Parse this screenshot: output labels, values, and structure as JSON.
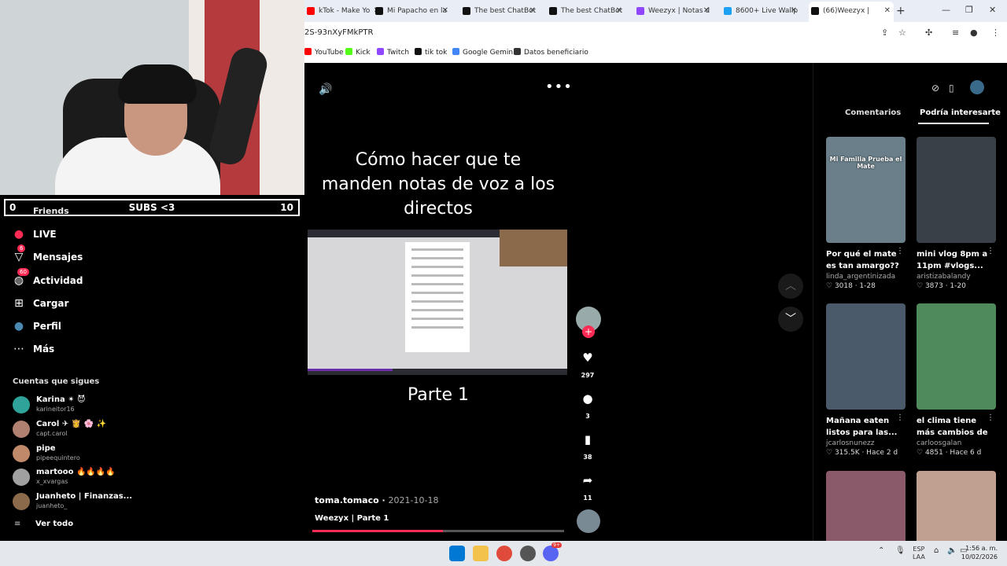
{
  "browser": {
    "tabs": [
      {
        "label": "kTok - Make Yo",
        "color": "#ff0000"
      },
      {
        "label": "Mi Papacho en la",
        "color": "#111111"
      },
      {
        "label": "The best ChatBot",
        "color": "#111111"
      },
      {
        "label": "The best ChatBot",
        "color": "#111111"
      },
      {
        "label": "Weezyx | Notas d",
        "color": "#9146ff"
      },
      {
        "label": "8600+ Live Wallp",
        "color": "#1da1f2"
      },
      {
        "label": "(66)Weezyx |",
        "color": "#111111"
      }
    ],
    "new_tab": "+",
    "url": "2S-93nXyFMkPTR",
    "bookmarks": [
      {
        "label": "YouTube",
        "color": "#ff0000"
      },
      {
        "label": "Kick",
        "color": "#53fc18"
      },
      {
        "label": "Twitch",
        "color": "#9146ff"
      },
      {
        "label": "tik tok",
        "color": "#111111"
      },
      {
        "label": "Google Gemini",
        "color": "#4285f4"
      },
      {
        "label": "Datos beneficiario",
        "color": "#333333"
      }
    ]
  },
  "stream_overlay": {
    "left": "0",
    "center": "SUBS <3",
    "right": "10"
  },
  "sidebar": {
    "friends": "Friends",
    "nav": [
      {
        "label": "LIVE",
        "icon": "live-icon",
        "badge": ""
      },
      {
        "label": "Mensajes",
        "icon": "messages-icon",
        "badge": "6"
      },
      {
        "label": "Actividad",
        "icon": "activity-icon",
        "badge": "60"
      },
      {
        "label": "Cargar",
        "icon": "upload-icon",
        "badge": ""
      },
      {
        "label": "Perfil",
        "icon": "profile-icon",
        "badge": ""
      },
      {
        "label": "Más",
        "icon": "more-icon",
        "badge": ""
      }
    ],
    "following_title": "Cuentas que sigues",
    "accounts": [
      {
        "name": "Karina ✴ 😈",
        "handle": "karineitor16",
        "color": "#2fa39a"
      },
      {
        "name": "Carol ✈ 👸 🌸 ✨",
        "handle": "capt.carol",
        "color": "#b08070"
      },
      {
        "name": "pipe",
        "handle": "pipeequintero",
        "color": "#c08a6a"
      },
      {
        "name": "martooo 🔥🔥🔥🔥",
        "handle": "x_xvargas",
        "color": "#a0a0a0"
      },
      {
        "name": "Juanheto | Finanzas...",
        "handle": "juanheto_",
        "color": "#8a6a4a"
      }
    ],
    "see_all": "Ver todo"
  },
  "video": {
    "title": "Cómo hacer que te manden notas de voz a los directos",
    "subtitle": "Parte 1",
    "author": "toma.tomaco",
    "date": "2021-10-18",
    "caption": "Weezyx | Parte 1",
    "progress": 0.52,
    "actions": [
      {
        "icon": "heart-icon",
        "count": "297"
      },
      {
        "icon": "comment-icon",
        "count": "3"
      },
      {
        "icon": "bookmark-icon",
        "count": "38"
      },
      {
        "icon": "share-icon",
        "count": "11"
      }
    ]
  },
  "right_panel": {
    "tabs": [
      "Comentarios",
      "Podría interesarte"
    ],
    "active_tab": "Podría interesarte",
    "cards": [
      {
        "caption": "Por qué el mate es tan amargo?? 😂 ...",
        "author": "linda_argentinizada",
        "stats": "3018 · 1-28",
        "color": "#6a7f8a",
        "overlay": "Mi Familia Prueba el Mate"
      },
      {
        "caption": "mini vlog 8pm a 11pm #vlogs...",
        "author": "aristizabalandy",
        "stats": "3873 · 1-20",
        "color": "#3a4048",
        "overlay": ""
      },
      {
        "caption": "Mañana eaten listos para las...",
        "author": "jcarlosnunezz",
        "stats": "315.5K · Hace 2 d",
        "color": "#4a5a6a",
        "overlay": ""
      },
      {
        "caption": "el clima tiene más cambios de hum...",
        "author": "carloosgalan",
        "stats": "4851 · Hace 6 d",
        "color": "#4f8a5a",
        "overlay": ""
      },
      {
        "caption": "",
        "author": "",
        "stats": "",
        "color": "#8a5a6a",
        "overlay": ""
      },
      {
        "caption": "",
        "author": "",
        "stats": "",
        "color": "#c0a090",
        "overlay": ""
      }
    ]
  },
  "taskbar": {
    "lang": "ESP",
    "region": "LAA",
    "time": "1:56 a. m.",
    "date": "10/02/2026",
    "discord_badge": "9+"
  }
}
